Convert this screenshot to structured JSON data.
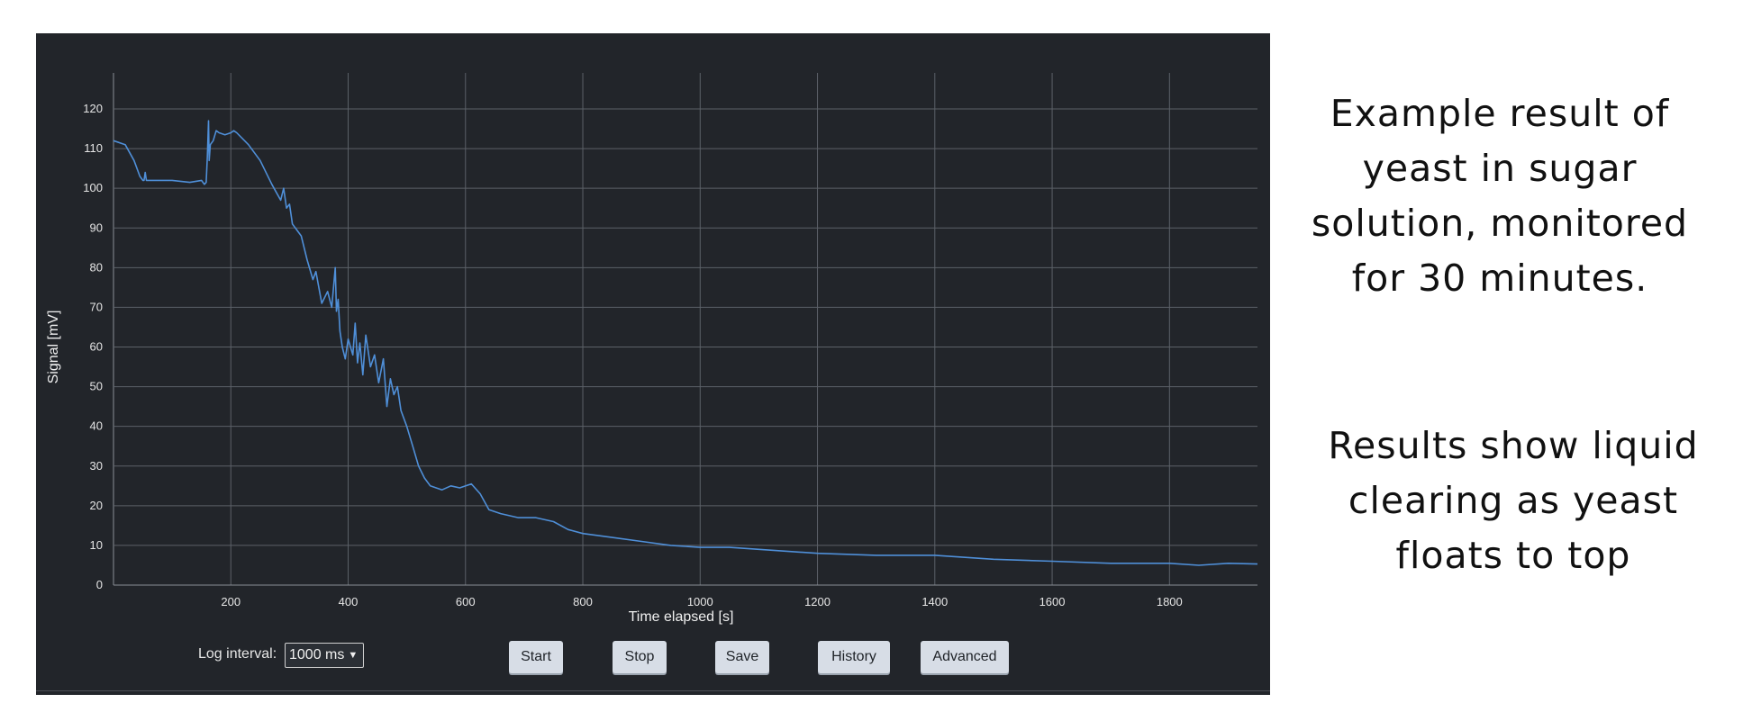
{
  "chart_data": {
    "type": "line",
    "xlabel": "Time elapsed [s]",
    "ylabel": "Signal [mV]",
    "xlim": [
      0,
      1950
    ],
    "ylim": [
      0,
      120
    ],
    "x_ticks": [
      200,
      400,
      600,
      800,
      1000,
      1200,
      1400,
      1600,
      1800
    ],
    "y_ticks": [
      0,
      10,
      20,
      30,
      40,
      50,
      60,
      70,
      80,
      90,
      100,
      110,
      120
    ],
    "grid": true,
    "line_color": "#4f8fd8",
    "series": [
      {
        "x": [
          0,
          20,
          35,
          45,
          50,
          52,
          54,
          56,
          60,
          100,
          130,
          150,
          155,
          158,
          160,
          162,
          163,
          165,
          170,
          175,
          180,
          190,
          200,
          205,
          210,
          230,
          250,
          270,
          285,
          290,
          295,
          300,
          305,
          310,
          320,
          330,
          340,
          345,
          355,
          365,
          372,
          378,
          380,
          383,
          386,
          390,
          395,
          400,
          408,
          412,
          416,
          420,
          425,
          430,
          438,
          445,
          452,
          460,
          466,
          472,
          478,
          484,
          490,
          500,
          510,
          520,
          530,
          540,
          550,
          560,
          575,
          590,
          610,
          625,
          640,
          660,
          690,
          720,
          750,
          775,
          800,
          850,
          900,
          950,
          1000,
          1050,
          1100,
          1200,
          1300,
          1400,
          1500,
          1600,
          1700,
          1800,
          1850,
          1900,
          1950
        ],
        "y": [
          112,
          111,
          107,
          103,
          102,
          102,
          104,
          102,
          102,
          102,
          101.5,
          102,
          101,
          101.5,
          108,
          117,
          107,
          111,
          112,
          114.5,
          114,
          113.5,
          114,
          114.5,
          114,
          111,
          107,
          101,
          97,
          100,
          95,
          96,
          91,
          90,
          88,
          82,
          77,
          79,
          71,
          74,
          70,
          80,
          69,
          72,
          64,
          60,
          57,
          62,
          58,
          66,
          56,
          61,
          53,
          63,
          55,
          58,
          51,
          57,
          45,
          52,
          48,
          50,
          44,
          40,
          35,
          30,
          27,
          25,
          24.5,
          24,
          25,
          24.5,
          25.5,
          23,
          19,
          18,
          17,
          17,
          16,
          14,
          13,
          12,
          11,
          10,
          9.5,
          9.5,
          9,
          8,
          7.5,
          7.5,
          6.5,
          6,
          5.5,
          5.5,
          5,
          5.5,
          5.3
        ]
      }
    ]
  },
  "controls": {
    "log_interval_label": "Log interval:",
    "log_interval_value": "1000 ms",
    "start_label": "Start",
    "stop_label": "Stop",
    "save_label": "Save",
    "history_label": "History",
    "advanced_label": "Advanced"
  },
  "captions": {
    "top": [
      "Example result of",
      "yeast in sugar",
      "solution, monitored",
      "for 30 minutes."
    ],
    "bottom": [
      "Results show liquid",
      "clearing as yeast",
      "floats to top"
    ]
  }
}
